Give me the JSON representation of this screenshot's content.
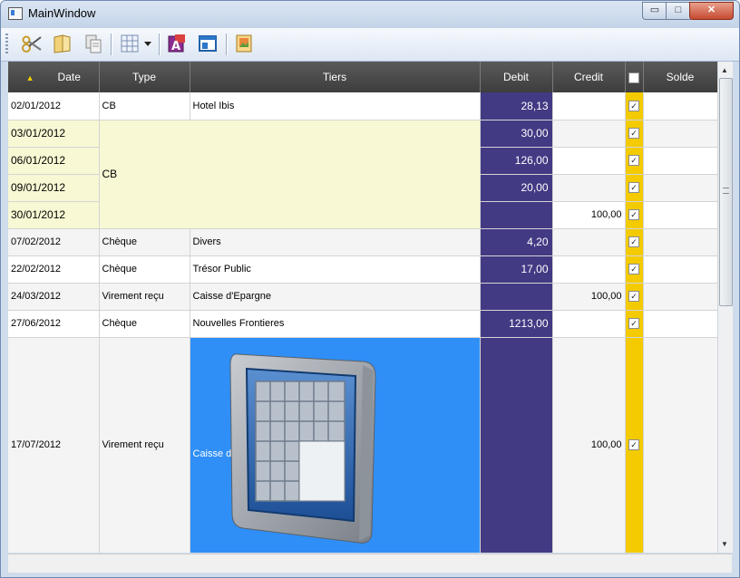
{
  "window": {
    "title": "MainWindow",
    "minimize_label": "▭",
    "maximize_label": "□",
    "close_label": "✕"
  },
  "toolbar": {
    "icons": [
      "cut-icon",
      "open-folder-icon",
      "copy-icon",
      "grid-icon",
      "dropdown-arrow-icon",
      "font-icon",
      "window-icon",
      "picture-icon"
    ]
  },
  "columns": {
    "date": "Date",
    "type": "Type",
    "tiers": "Tiers",
    "debit": "Debit",
    "credit": "Credit",
    "solde": "Solde",
    "sort_indicator": "▲"
  },
  "rows": [
    {
      "date": "02/01/2012",
      "type": "CB",
      "tiers": "Hotel Ibis",
      "debit": "28,13",
      "credit": "",
      "checked": true
    }
  ],
  "group": {
    "label": "CB",
    "rows": [
      {
        "date": "03/01/2012",
        "debit": "30,00",
        "credit": ""
      },
      {
        "date": "06/01/2012",
        "debit": "126,00",
        "credit": ""
      },
      {
        "date": "09/01/2012",
        "debit": "20,00",
        "credit": ""
      },
      {
        "date": "30/01/2012",
        "debit": "",
        "credit": "100,00"
      }
    ]
  },
  "rows2": [
    {
      "date": "07/02/2012",
      "type": "Chèque",
      "tiers": "Divers",
      "debit": "4,20",
      "credit": ""
    },
    {
      "date": "22/02/2012",
      "type": "Chèque",
      "tiers": "Trésor Public",
      "debit": "17,00",
      "credit": ""
    },
    {
      "date": "24/03/2012",
      "type": "Virement reçu",
      "tiers": "Caisse d'Epargne",
      "debit": "",
      "credit": "100,00"
    },
    {
      "date": "27/06/2012",
      "type": "Chèque",
      "tiers": "Nouvelles Frontieres",
      "debit": "1213,00",
      "credit": ""
    }
  ],
  "last_row": {
    "date": "17/07/2012",
    "type": "Virement reçu",
    "tiers": "Caisse d",
    "debit": "",
    "credit": "100,00"
  },
  "colors": {
    "debit_bg": "#433a84",
    "check_bg": "#f3cb00",
    "group_bg": "#f8f8d4",
    "selection_bg": "#2f8ff7"
  }
}
